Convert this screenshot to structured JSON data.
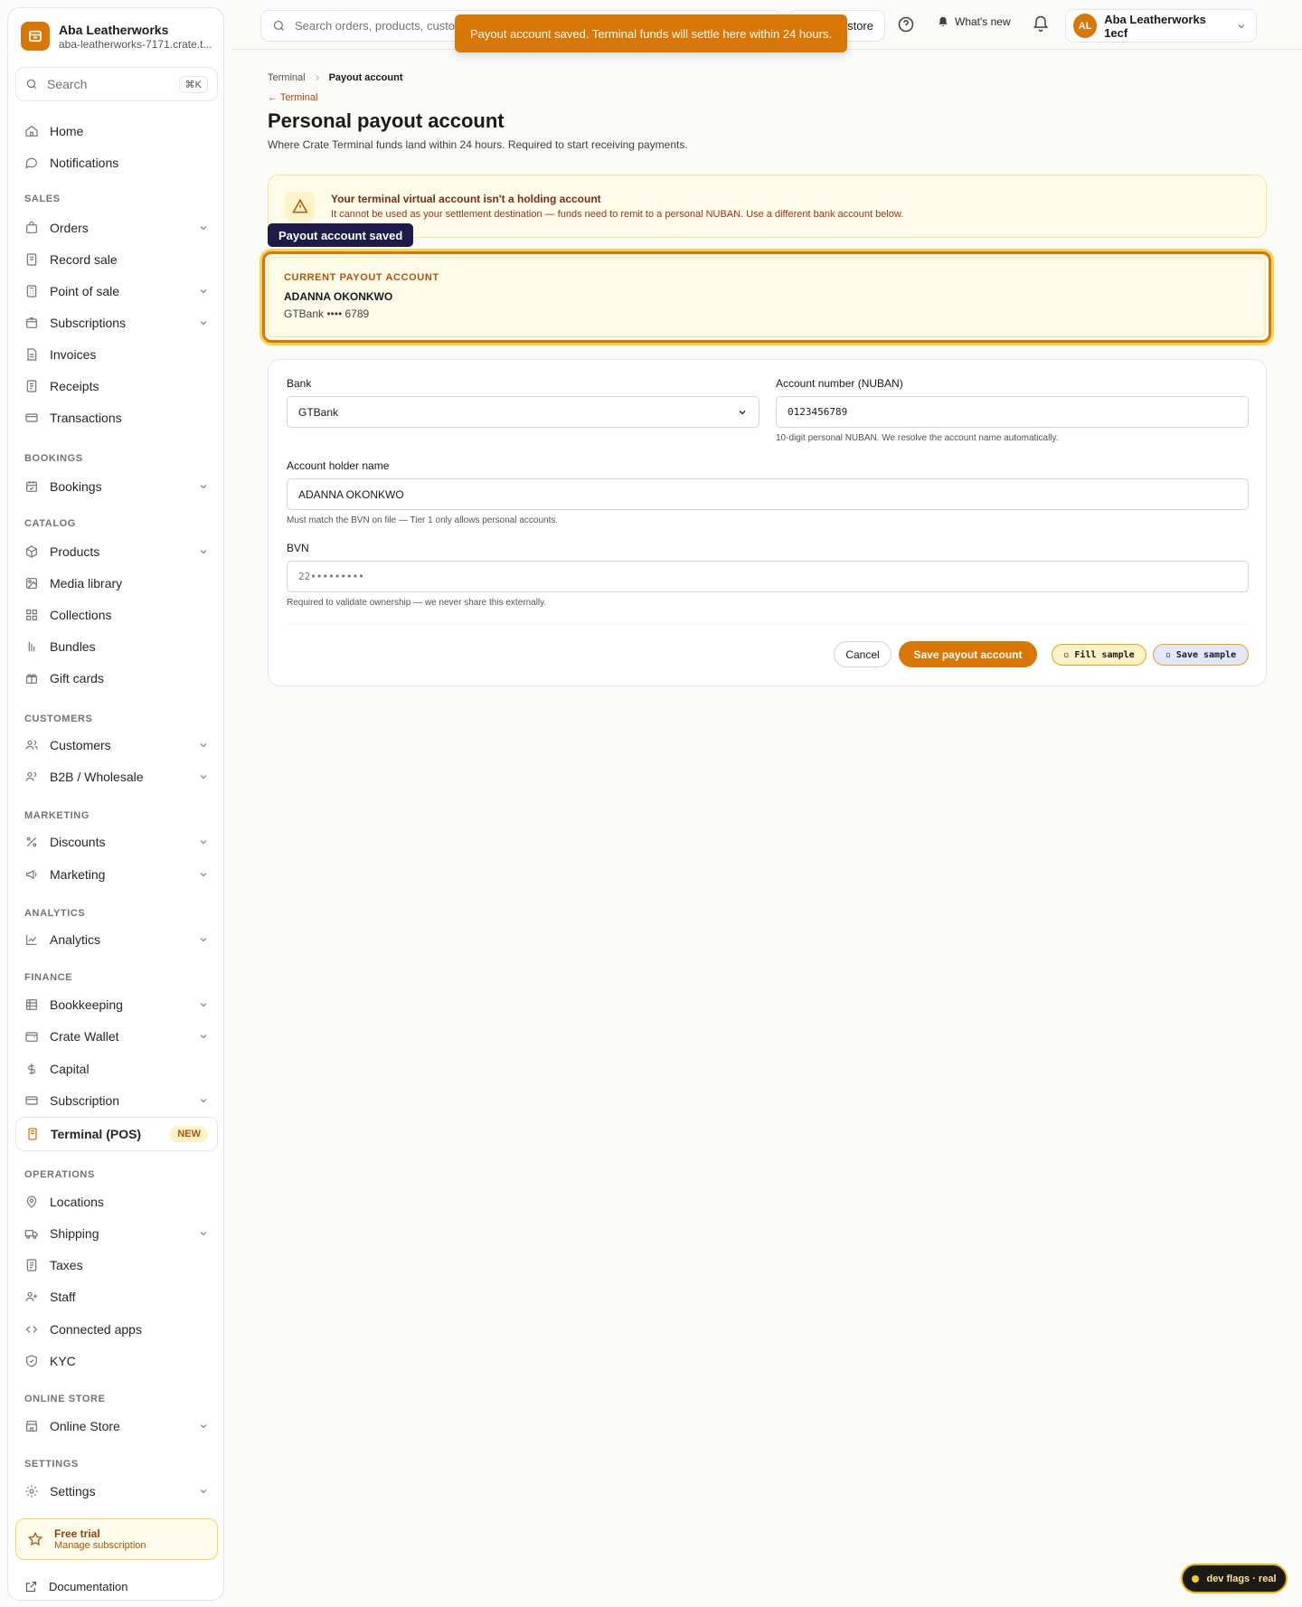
{
  "brand": {
    "name": "Aba Leatherworks",
    "domain": "aba-leatherworks-7171.crate.t..."
  },
  "sidebar_search": {
    "label": "Search",
    "shortcut": "⌘K"
  },
  "nav": {
    "home": "Home",
    "notifications": "Notifications",
    "sales_title": "SALES",
    "orders": "Orders",
    "record_sale": "Record sale",
    "pos": "Point of sale",
    "subscriptions": "Subscriptions",
    "invoices": "Invoices",
    "receipts": "Receipts",
    "transactions": "Transactions",
    "bookings_title": "BOOKINGS",
    "bookings": "Bookings",
    "catalog_title": "CATALOG",
    "products": "Products",
    "media": "Media library",
    "collections": "Collections",
    "bundles": "Bundles",
    "giftcards": "Gift cards",
    "customers_title": "CUSTOMERS",
    "customers": "Customers",
    "b2b": "B2B / Wholesale",
    "marketing_title": "MARKETING",
    "discounts": "Discounts",
    "marketing": "Marketing",
    "analytics_title": "ANALYTICS",
    "analytics": "Analytics",
    "finance_title": "FINANCE",
    "bookkeeping": "Bookkeeping",
    "wallet": "Crate Wallet",
    "capital": "Capital",
    "subscription": "Subscription",
    "terminal": "Terminal (POS)",
    "terminal_badge": "NEW",
    "operations_title": "OPERATIONS",
    "locations": "Locations",
    "shipping": "Shipping",
    "taxes": "Taxes",
    "staff": "Staff",
    "apps": "Connected apps",
    "kyc": "KYC",
    "store_title": "ONLINE STORE",
    "online_store": "Online Store",
    "settings_title": "SETTINGS",
    "settings": "Settings"
  },
  "trial": {
    "title": "Free trial",
    "subtitle": "Manage subscription"
  },
  "docs": "Documentation",
  "topbar": {
    "search_placeholder": "Search orders, products, custom",
    "store_label": "store",
    "whats_new": "What's new",
    "avatar": "AL",
    "account": "Aba Leatherworks 1ecf"
  },
  "toast": "Payout account saved. Terminal funds will settle here within 24 hours.",
  "breadcrumb": {
    "parent": "Terminal",
    "current": "Payout account"
  },
  "back_link": "← Terminal",
  "page": {
    "title": "Personal payout account",
    "subtitle": "Where Crate Terminal funds land within 24 hours. Required to start receiving payments."
  },
  "warning": {
    "title": "Your terminal virtual account isn't a holding account",
    "text": "It cannot be used as your settlement destination — funds need to remit to a personal NUBAN. Use a different bank account below."
  },
  "tooltip": "Payout account saved",
  "current_account": {
    "label": "CURRENT PAYOUT ACCOUNT",
    "name": "ADANNA OKONKWO",
    "bank": "GTBank •••• 6789"
  },
  "form": {
    "bank_label": "Bank",
    "bank_value": "GTBank",
    "nuban_label": "Account number (NUBAN)",
    "nuban_value": "0123456789",
    "nuban_help": "10-digit personal NUBAN. We resolve the account name automatically.",
    "holder_label": "Account holder name",
    "holder_value": "ADANNA OKONKWO",
    "holder_help": "Must match the BVN on file — Tier 1 only allows personal accounts.",
    "bvn_label": "BVN",
    "bvn_value": "22•••••••••",
    "bvn_help": "Required to validate ownership — we never share this externally.",
    "cancel": "Cancel",
    "save": "Save payout account",
    "fill_sample": "▫ Fill sample",
    "save_sample": "▫ Save sample"
  },
  "dev_flags": "dev flags · real"
}
